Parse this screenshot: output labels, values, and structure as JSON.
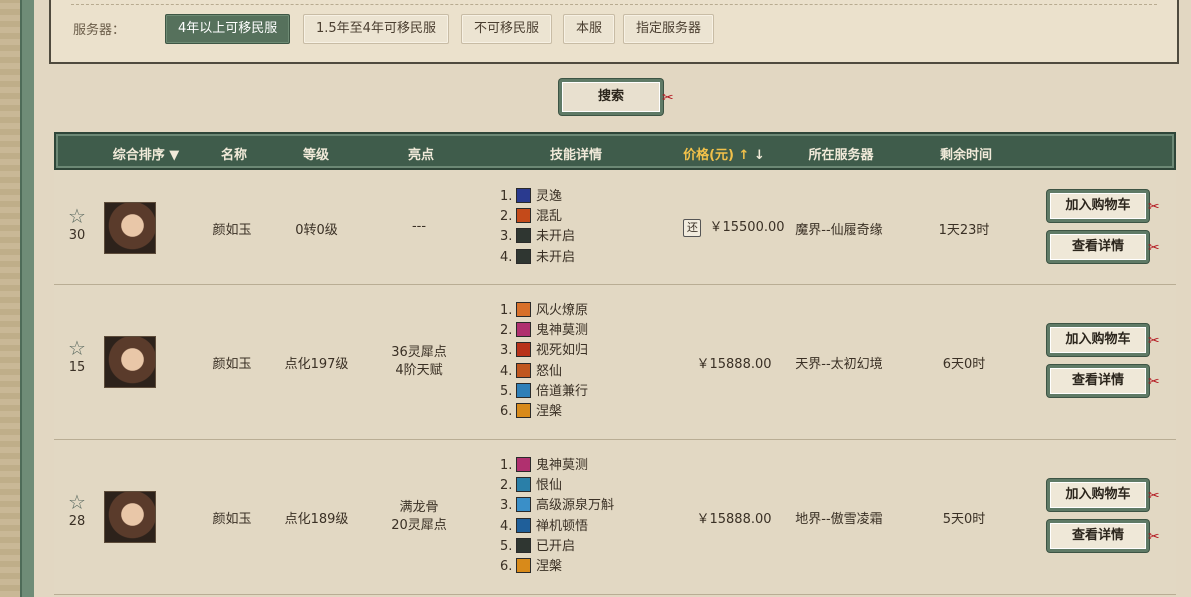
{
  "filter": {
    "label": "服务器：",
    "options": [
      {
        "label": "4年以上可移民服",
        "active": true
      },
      {
        "label": "1.5年至4年可移民服",
        "active": false
      },
      {
        "label": "不可移民服",
        "active": false
      },
      {
        "label": "本服",
        "active": false
      },
      {
        "label": "指定服务器",
        "active": false
      }
    ]
  },
  "search": {
    "label": "搜索"
  },
  "table": {
    "headers": {
      "sort": "综合排序",
      "name": "名称",
      "level": "等级",
      "highlight": "亮点",
      "skills": "技能详情",
      "price": "价格(元)",
      "server": "所在服务器",
      "time": "剩余时间"
    },
    "rows": [
      {
        "fav_count": "30",
        "name": "颜如玉",
        "level": "0转0级",
        "highlight_1": "---",
        "highlight_2": "",
        "skills": [
          {
            "num": "1.",
            "name": "灵逸",
            "color": "#2a3a8f"
          },
          {
            "num": "2.",
            "name": "混乱",
            "color": "#c44a1a"
          },
          {
            "num": "3.",
            "name": "未开启",
            "color": "#2f3631"
          },
          {
            "num": "4.",
            "name": "未开启",
            "color": "#2f3631"
          }
        ],
        "refund_tag": "还",
        "price": "￥15500.00",
        "server": "魔界--仙履奇缘",
        "time": "1天23时",
        "cart_label": "加入购物车",
        "detail_label": "查看详情"
      },
      {
        "fav_count": "15",
        "name": "颜如玉",
        "level": "点化197级",
        "highlight_1": "36灵犀点",
        "highlight_2": "4阶天赋",
        "skills": [
          {
            "num": "1.",
            "name": "风火燎原",
            "color": "#d8702a"
          },
          {
            "num": "2.",
            "name": "鬼神莫测",
            "color": "#b0306f"
          },
          {
            "num": "3.",
            "name": "视死如归",
            "color": "#b8321a"
          },
          {
            "num": "4.",
            "name": "怒仙",
            "color": "#c0561e"
          },
          {
            "num": "5.",
            "name": "倍道兼行",
            "color": "#2e7fb8"
          },
          {
            "num": "6.",
            "name": "涅槃",
            "color": "#d88a1a"
          }
        ],
        "refund_tag": "",
        "price": "￥15888.00",
        "server": "天界--太初幻境",
        "time": "6天0时",
        "cart_label": "加入购物车",
        "detail_label": "查看详情"
      },
      {
        "fav_count": "28",
        "name": "颜如玉",
        "level": "点化189级",
        "highlight_1": "满龙骨",
        "highlight_2": "20灵犀点",
        "skills": [
          {
            "num": "1.",
            "name": "鬼神莫测",
            "color": "#b0306f"
          },
          {
            "num": "2.",
            "name": "恨仙",
            "color": "#2a7fa8"
          },
          {
            "num": "3.",
            "name": "高级源泉万斛",
            "color": "#3a8fc8"
          },
          {
            "num": "4.",
            "name": "禅机顿悟",
            "color": "#1f5f9a"
          },
          {
            "num": "5.",
            "name": "已开启",
            "color": "#2f3631"
          },
          {
            "num": "6.",
            "name": "涅槃",
            "color": "#d88a1a"
          }
        ],
        "refund_tag": "",
        "price": "￥15888.00",
        "server": "地界--傲雪凌霜",
        "time": "5天0时",
        "cart_label": "加入购物车",
        "detail_label": "查看详情"
      }
    ]
  }
}
